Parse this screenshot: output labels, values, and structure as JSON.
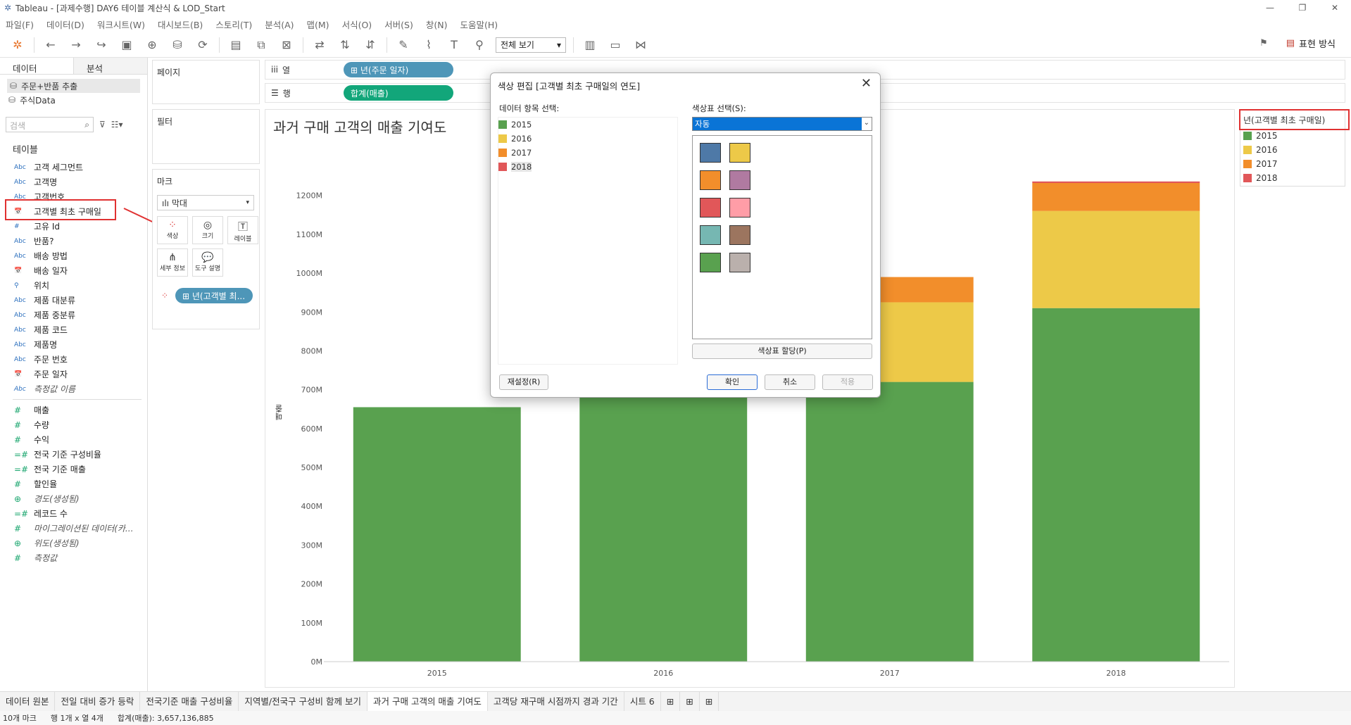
{
  "window": {
    "title": "Tableau - [과제수행] DAY6 테이블 계산식 & LOD_Start"
  },
  "menu": [
    "파일(F)",
    "데이터(D)",
    "워크시트(W)",
    "대시보드(B)",
    "스토리(T)",
    "분석(A)",
    "맵(M)",
    "서식(O)",
    "서버(S)",
    "창(N)",
    "도움말(H)"
  ],
  "toolbar": {
    "fit_label": "전체 보기",
    "show_me_label": "표현 방식"
  },
  "data_pane": {
    "tabs": [
      "데이터",
      "분석"
    ],
    "sources": [
      "주문+반품 추출",
      "주식Data"
    ],
    "search_placeholder": "검색",
    "tables_header": "테이블",
    "dimensions": [
      {
        "type": "Abc",
        "name": "고객 세그먼트"
      },
      {
        "type": "Abc",
        "name": "고객명"
      },
      {
        "type": "Abc",
        "name": "고객번호"
      },
      {
        "type": "📅",
        "name": "고객별 최초 구매일"
      },
      {
        "type": "#",
        "name": "고유 Id"
      },
      {
        "type": "Abc",
        "name": "반품?"
      },
      {
        "type": "Abc",
        "name": "배송 방법"
      },
      {
        "type": "📅",
        "name": "배송 일자"
      },
      {
        "type": "⚲",
        "name": "위치"
      },
      {
        "type": "Abc",
        "name": "제품 대분류"
      },
      {
        "type": "Abc",
        "name": "제품 중분류"
      },
      {
        "type": "Abc",
        "name": "제품 코드"
      },
      {
        "type": "Abc",
        "name": "제품명"
      },
      {
        "type": "Abc",
        "name": "주문 번호"
      },
      {
        "type": "📅",
        "name": "주문 일자"
      },
      {
        "type": "Abc",
        "name": "측정값 이름"
      }
    ],
    "measures": [
      {
        "type": "#",
        "name": "매출"
      },
      {
        "type": "#",
        "name": "수량"
      },
      {
        "type": "#",
        "name": "수익"
      },
      {
        "type": "=#",
        "name": "전국 기준 구성비율"
      },
      {
        "type": "=#",
        "name": "전국 기준 매출"
      },
      {
        "type": "#",
        "name": "할인율"
      },
      {
        "type": "⊕",
        "name": "경도(생성됨)"
      },
      {
        "type": "=#",
        "name": "레코드 수"
      },
      {
        "type": "#",
        "name": "마이그레이션된 데이터(카..."
      },
      {
        "type": "⊕",
        "name": "위도(생성됨)"
      },
      {
        "type": "#",
        "name": "측정값"
      }
    ]
  },
  "shelves": {
    "pages_label": "페이지",
    "filters_label": "필터",
    "marks_label": "마크",
    "mark_type": "막대",
    "mark_buttons": [
      "색상",
      "크기",
      "레이블",
      "세부 정보",
      "도구 설명"
    ],
    "color_pill": "⊞ 년(고객별 최...",
    "columns_label": "열",
    "rows_label": "행",
    "columns_pill": "⊞ 년(주문 일자)",
    "rows_pill": "합계(매출)"
  },
  "view": {
    "title": "과거 구매 고객의 매출 기여도",
    "y_axis_label": "매출",
    "legend_title": "년(고객별 최초 구매일)",
    "legend": [
      {
        "label": "2015",
        "color": "#59a14f"
      },
      {
        "label": "2016",
        "color": "#edc948"
      },
      {
        "label": "2017",
        "color": "#f28e2b"
      },
      {
        "label": "2018",
        "color": "#e15759"
      }
    ]
  },
  "chart_data": {
    "type": "bar",
    "stacked": true,
    "categories": [
      "2015",
      "2016",
      "2017",
      "2018"
    ],
    "series": [
      {
        "name": "2015",
        "color": "#59a14f",
        "values": [
          655,
          730,
          720,
          910
        ]
      },
      {
        "name": "2016",
        "color": "#edc948",
        "values": [
          0,
          205,
          205,
          250
        ]
      },
      {
        "name": "2017",
        "color": "#f28e2b",
        "values": [
          0,
          0,
          65,
          72
        ]
      },
      {
        "name": "2018",
        "color": "#e15759",
        "values": [
          0,
          0,
          0,
          4
        ]
      }
    ],
    "ylabel": "매출",
    "ylim": [
      0,
      1290
    ],
    "yticks": [
      "0M",
      "100M",
      "200M",
      "300M",
      "400M",
      "500M",
      "600M",
      "700M",
      "800M",
      "900M",
      "1000M",
      "1100M",
      "1200M"
    ],
    "ytick_values": [
      0,
      100,
      200,
      300,
      400,
      500,
      600,
      700,
      800,
      900,
      1000,
      1100,
      1200
    ]
  },
  "dialog": {
    "title": "색상 편집 [고객별 최초 구매일의 연도]",
    "items_label": "데이터 항목 선택:",
    "palette_label": "색상표 선택(S):",
    "palette_value": "자동",
    "items": [
      {
        "label": "2015",
        "color": "#59a14f"
      },
      {
        "label": "2016",
        "color": "#edc948"
      },
      {
        "label": "2017",
        "color": "#f28e2b"
      },
      {
        "label": "2018",
        "color": "#e15759"
      }
    ],
    "palette_colors": [
      "#4e79a7",
      "#edc948",
      "#f28e2b",
      "#b07aa1",
      "#e15759",
      "#ff9da7",
      "#76b7b2",
      "#9c755f",
      "#59a14f",
      "#bab0ac"
    ],
    "assign_button": "색상표 할당(P)",
    "reset_button": "재설정(R)",
    "ok_button": "확인",
    "cancel_button": "취소",
    "apply_button": "적용"
  },
  "sheet_tabs": [
    "데이터 원본",
    "전일 대비 증가 등락",
    "전국기준 매출 구성비율",
    "지역별/전국구 구성비 함께 보기",
    "과거 구매 고객의 매출 기여도",
    "고객당 재구매 시점까지 경과 기간",
    "시트 6"
  ],
  "status": {
    "marks": "10개 마크",
    "rows_cols": "행 1개 x 열 4개",
    "sum": "합계(매출): 3,657,136,885"
  }
}
